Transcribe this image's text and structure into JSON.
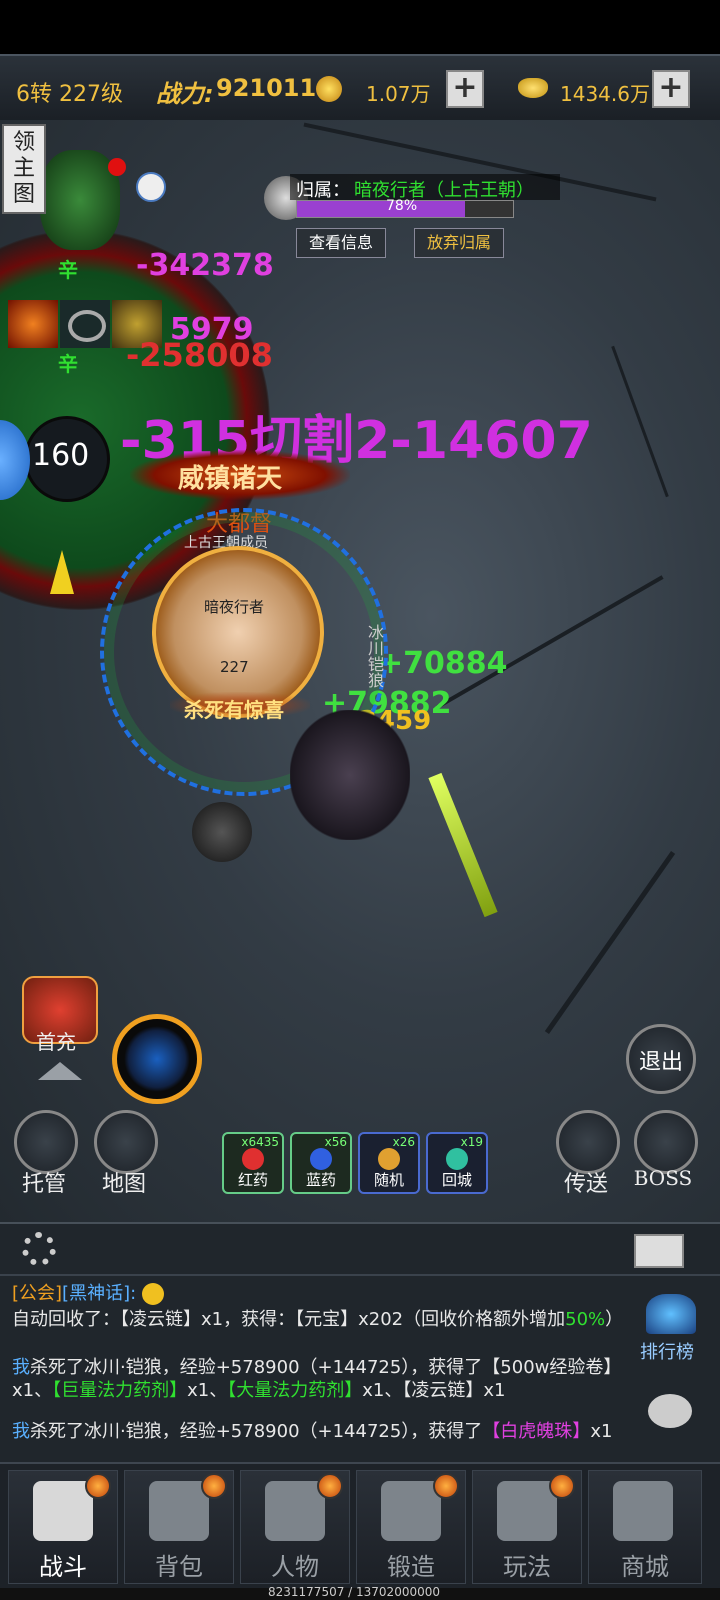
{
  "topbar": {
    "level": "6转 227级",
    "power_label": "战力:",
    "power_value": "921011",
    "currency1": "1.07万",
    "currency2": "1434.6万",
    "plus": "+"
  },
  "side": {
    "lord_map": "领主图"
  },
  "ownership": {
    "label": "归属：",
    "owner": "暗夜行者（上古王朝）",
    "percent_text": "78%",
    "percent": 0.78,
    "view_btn": "查看信息",
    "abandon_btn": "放弃归属"
  },
  "boss_ring": {
    "value": "160"
  },
  "floating_text": [
    {
      "text": "-342378",
      "color": "#e040e0"
    },
    {
      "text": "5979",
      "color": "#e040e0"
    },
    {
      "text": "-258008",
      "color": "#e03030"
    },
    {
      "text": "-315切割2-14607",
      "color": "#d030e0"
    },
    {
      "text": "+70884",
      "color": "#40e040"
    },
    {
      "text": "+79882",
      "color": "#40e040"
    },
    {
      "text": "-2459",
      "color": "#f0c020"
    },
    {
      "text": "辛",
      "color": "#30e030"
    },
    {
      "text": "辛",
      "color": "#30e030"
    }
  ],
  "player": {
    "title": "威镇诸天",
    "rank": "大都督",
    "guild": "上古王朝成员",
    "name": "暗夜行者",
    "level": "227",
    "kill_banner": "杀死有惊喜"
  },
  "monster_name": "冰川铠狼",
  "buttons": {
    "first_recharge": "首充",
    "exit": "退出",
    "auto": "托管",
    "map": "地图",
    "teleport": "传送",
    "boss": "BOSS",
    "rank": "排行榜"
  },
  "potions": [
    {
      "label": "红药",
      "count": "x6435",
      "color": "#e03030"
    },
    {
      "label": "蓝药",
      "count": "x56",
      "color": "#3060e0"
    },
    {
      "label": "随机",
      "count": "x26",
      "color": "#e0a030"
    },
    {
      "label": "回城",
      "count": "x19",
      "color": "#30c0a0"
    }
  ],
  "chat": {
    "line1_tag1": "[公会]",
    "line1_tag2": "[黑神话]:",
    "line2": "自动回收了：【凌云链】x1，获得：【元宝】x202（回收价格额外增加",
    "line2_pct": "50%",
    "line2_end": "）",
    "line3_me": "我",
    "line3": "杀死了冰川·铠狼，经验+578900（+144725），获得了【500w经验卷】x1、",
    "line3_g1": "【巨量法力药剂】",
    "line3_mid": "x1、",
    "line3_g2": "【大量法力药剂】",
    "line3_end": "x1、【凌云链】x1",
    "line4_me": "我",
    "line4": "杀死了冰川·铠狼，经验+578900（+144725），获得了",
    "line4_item": "【白虎魄珠】",
    "line4_end": "x1"
  },
  "nav": [
    {
      "label": "战斗",
      "active": true
    },
    {
      "label": "背包",
      "active": false
    },
    {
      "label": "人物",
      "active": false
    },
    {
      "label": "锻造",
      "active": false
    },
    {
      "label": "玩法",
      "active": false
    },
    {
      "label": "商城",
      "active": false
    }
  ],
  "footer": "8231177507 / 13702000000"
}
